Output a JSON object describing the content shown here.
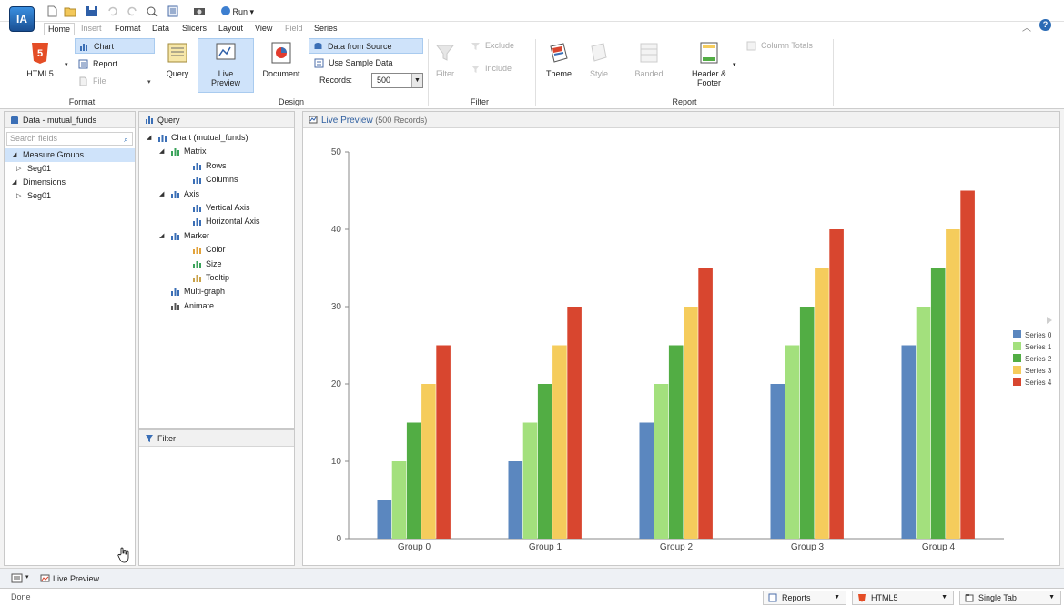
{
  "app": {
    "logo": "IA"
  },
  "quickbar": {
    "run_label": "Run"
  },
  "tabs": [
    {
      "label": "Home",
      "state": "active"
    },
    {
      "label": "Insert",
      "state": "disabled"
    },
    {
      "label": "Format",
      "state": "normal"
    },
    {
      "label": "Data",
      "state": "normal"
    },
    {
      "label": "Slicers",
      "state": "normal"
    },
    {
      "label": "Layout",
      "state": "normal"
    },
    {
      "label": "View",
      "state": "normal"
    },
    {
      "label": "Field",
      "state": "disabled"
    },
    {
      "label": "Series",
      "state": "normal"
    }
  ],
  "ribbon": {
    "format": {
      "group_label": "Format",
      "html5_label": "HTML5",
      "chart_label": "Chart",
      "report_label": "Report",
      "file_label": "File"
    },
    "design": {
      "group_label": "Design",
      "query_label": "Query",
      "live_preview_label_1": "Live",
      "live_preview_label_2": "Preview",
      "document_label": "Document",
      "data_from_source_label": "Data from Source",
      "use_sample_data_label": "Use Sample Data",
      "records_label": "Records:",
      "records_value": "500"
    },
    "filter": {
      "group_label": "Filter",
      "filter_label": "Filter",
      "exclude_label": "Exclude",
      "include_label": "Include"
    },
    "report": {
      "group_label": "Report",
      "theme_label": "Theme",
      "style_label": "Style",
      "banded_label": "Banded",
      "header_footer_label_1": "Header &",
      "header_footer_label_2": "Footer",
      "column_totals_label": "Column Totals"
    }
  },
  "data_panel": {
    "title": "Data - mutual_funds",
    "search_placeholder": "Search fields",
    "tree": [
      {
        "label": "Measure Groups",
        "level": 0,
        "expanded": true,
        "selected": true
      },
      {
        "label": "Seg01",
        "level": 1,
        "expanded": false,
        "selected": false
      },
      {
        "label": "Dimensions",
        "level": 0,
        "expanded": true,
        "selected": false
      },
      {
        "label": "Seg01",
        "level": 1,
        "expanded": false,
        "selected": false
      }
    ]
  },
  "query_panel": {
    "title": "Query",
    "tree": [
      {
        "label": "Chart (mutual_funds)",
        "level": 0,
        "toggle": "open",
        "icon": "chart-icon",
        "color": "#3b6fb6"
      },
      {
        "label": "Matrix",
        "level": 1,
        "toggle": "open",
        "icon": "matrix-icon",
        "color": "#3aa35a"
      },
      {
        "label": "Rows",
        "level": 2,
        "toggle": "",
        "icon": "rows-icon",
        "color": "#3b6fb6"
      },
      {
        "label": "Columns",
        "level": 2,
        "toggle": "",
        "icon": "columns-icon",
        "color": "#3b6fb6"
      },
      {
        "label": "Axis",
        "level": 1,
        "toggle": "open",
        "icon": "axis-icon",
        "color": "#3b6fb6"
      },
      {
        "label": "Vertical Axis",
        "level": 2,
        "toggle": "",
        "icon": "vertical-axis-icon",
        "color": "#3b6fb6"
      },
      {
        "label": "Horizontal Axis",
        "level": 2,
        "toggle": "",
        "icon": "horizontal-axis-icon",
        "color": "#3b6fb6"
      },
      {
        "label": "Marker",
        "level": 1,
        "toggle": "open",
        "icon": "marker-icon",
        "color": "#3b6fb6"
      },
      {
        "label": "Color",
        "level": 2,
        "toggle": "",
        "icon": "color-palette-icon",
        "color": "#e2a23a"
      },
      {
        "label": "Size",
        "level": 2,
        "toggle": "",
        "icon": "size-icon",
        "color": "#3aa35a"
      },
      {
        "label": "Tooltip",
        "level": 2,
        "toggle": "",
        "icon": "tooltip-icon",
        "color": "#c9a24a"
      },
      {
        "label": "Multi-graph",
        "level": 1,
        "toggle": "",
        "icon": "multi-graph-icon",
        "color": "#3b6fb6"
      },
      {
        "label": "Animate",
        "level": 1,
        "toggle": "",
        "icon": "animate-icon",
        "color": "#555555"
      }
    ]
  },
  "filter_panel": {
    "title": "Filter"
  },
  "preview_panel": {
    "title": "Live Preview",
    "records_note": "(500 Records)"
  },
  "chart_data": {
    "type": "bar",
    "categories": [
      "Group 0",
      "Group 1",
      "Group 2",
      "Group 3",
      "Group 4"
    ],
    "series": [
      {
        "name": "Series 0",
        "color": "#5b87bf",
        "values": [
          5,
          10,
          15,
          20,
          25
        ]
      },
      {
        "name": "Series 1",
        "color": "#a3e07d",
        "values": [
          10,
          15,
          20,
          25,
          30
        ]
      },
      {
        "name": "Series 2",
        "color": "#52ad44",
        "values": [
          15,
          20,
          25,
          30,
          35
        ]
      },
      {
        "name": "Series 3",
        "color": "#f5cc5c",
        "values": [
          20,
          25,
          30,
          35,
          40
        ]
      },
      {
        "name": "Series 4",
        "color": "#d8462f",
        "values": [
          25,
          30,
          35,
          40,
          45
        ]
      }
    ],
    "yticks": [
      0,
      10,
      20,
      30,
      40,
      50
    ],
    "ylim": [
      0,
      50
    ],
    "grid": false,
    "legend": "right"
  },
  "bottom_bar": {
    "live_preview_tab_label": "Live Preview"
  },
  "statusbar": {
    "status": "Done",
    "reports_label": "Reports",
    "html5_label": "HTML5",
    "single_tab_label": "Single Tab"
  }
}
